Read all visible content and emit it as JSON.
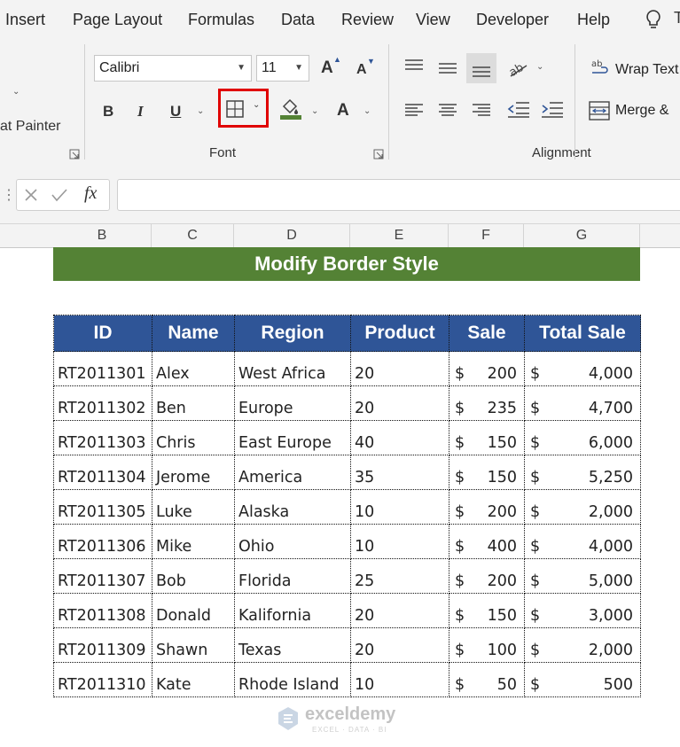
{
  "menu": [
    "Insert",
    "Page Layout",
    "Formulas",
    "Data",
    "Review",
    "View",
    "Developer",
    "Help"
  ],
  "ribbon": {
    "clipboard": {
      "format_painter": "at Painter"
    },
    "font": {
      "group_label": "Font",
      "font_name": "Calibri",
      "font_size": "11",
      "bold": "B",
      "italic": "I",
      "underline": "U",
      "font_color": "A",
      "grow_font": "A",
      "shrink_font": "A"
    },
    "alignment": {
      "group_label": "Alignment",
      "wrap_text": "Wrap Text",
      "merge": "Merge &"
    }
  },
  "formula_bar": {
    "fx_label": "fx",
    "value": ""
  },
  "columns": [
    "B",
    "C",
    "D",
    "E",
    "F",
    "G"
  ],
  "sheet": {
    "title": "Modify Border Style",
    "title_color": "#548235",
    "header_color": "#2f5597",
    "headers": [
      "ID",
      "Name",
      "Region",
      "Product",
      "Sale",
      "Total Sale"
    ],
    "currency_symbol": "$",
    "rows": [
      {
        "id": "RT2011301",
        "name": "Alex",
        "region": "West Africa",
        "product": "20",
        "sale": "200",
        "total": "4,000"
      },
      {
        "id": "RT2011302",
        "name": "Ben",
        "region": "Europe",
        "product": "20",
        "sale": "235",
        "total": "4,700"
      },
      {
        "id": "RT2011303",
        "name": "Chris",
        "region": "East Europe",
        "product": "40",
        "sale": "150",
        "total": "6,000"
      },
      {
        "id": "RT2011304",
        "name": "Jerome",
        "region": "America",
        "product": "35",
        "sale": "150",
        "total": "5,250"
      },
      {
        "id": "RT2011305",
        "name": "Luke",
        "region": "Alaska",
        "product": "10",
        "sale": "200",
        "total": "2,000"
      },
      {
        "id": "RT2011306",
        "name": "Mike",
        "region": "Ohio",
        "product": "10",
        "sale": "400",
        "total": "4,000"
      },
      {
        "id": "RT2011307",
        "name": "Bob",
        "region": "Florida",
        "product": "25",
        "sale": "200",
        "total": "5,000"
      },
      {
        "id": "RT2011308",
        "name": "Donald",
        "region": "Kalifornia",
        "product": "20",
        "sale": "150",
        "total": "3,000"
      },
      {
        "id": "RT2011309",
        "name": "Shawn",
        "region": "Texas",
        "product": "20",
        "sale": "100",
        "total": "2,000"
      },
      {
        "id": "RT2011310",
        "name": "Kate",
        "region": "Rhode Island",
        "product": "10",
        "sale": "50",
        "total": "500"
      }
    ]
  },
  "watermark": {
    "brand": "exceldemy",
    "tagline": "EXCEL · DATA · BI"
  },
  "colors": {
    "highlight_box": "#e00000",
    "accent_green": "#548235",
    "accent_blue": "#2f5597"
  }
}
